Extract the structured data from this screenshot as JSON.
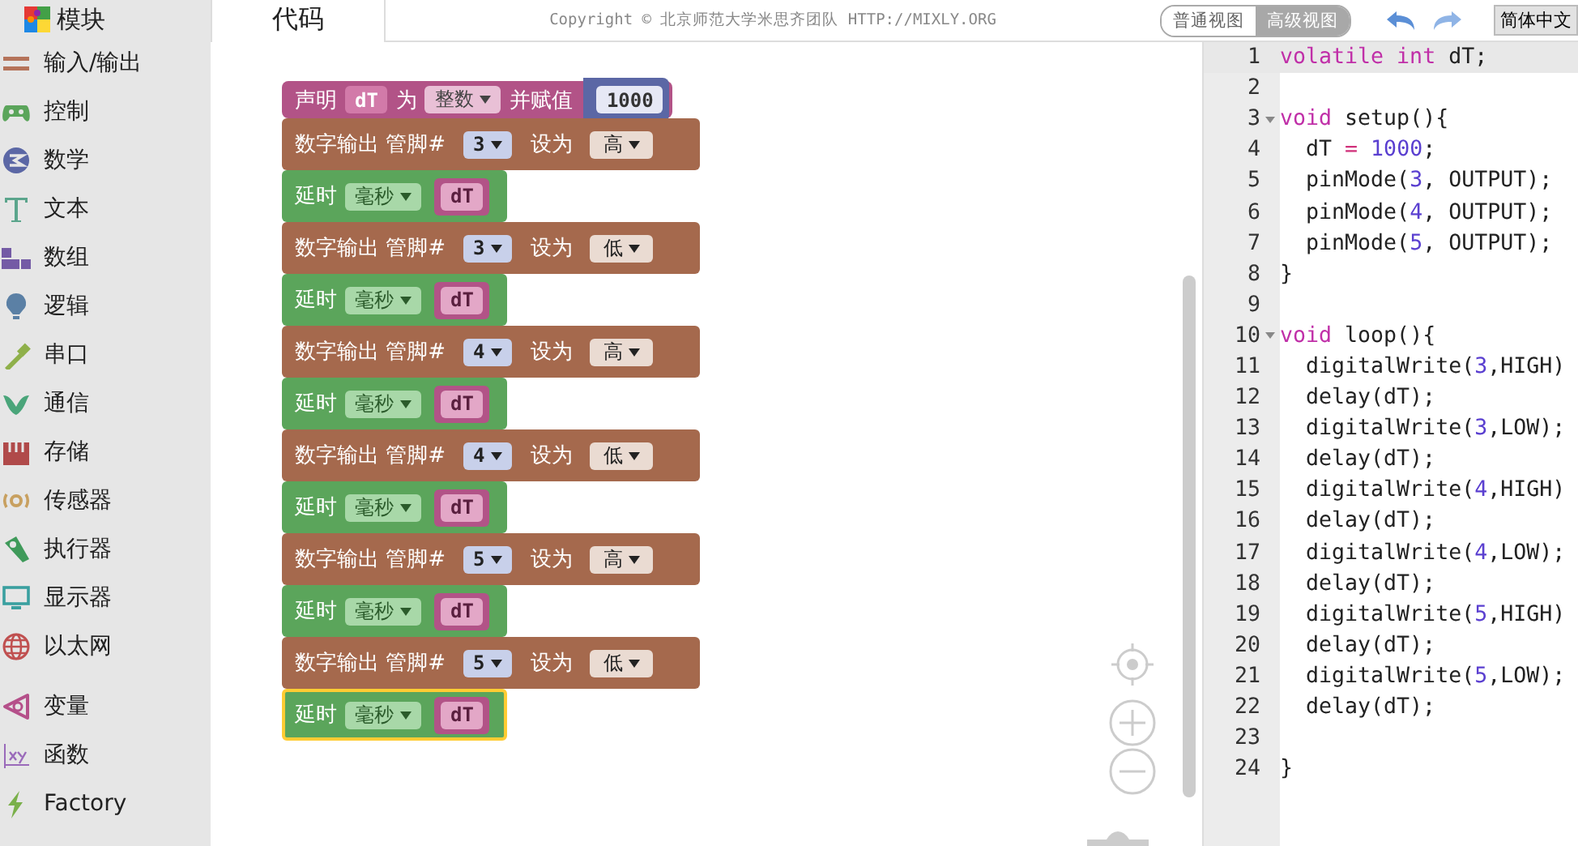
{
  "sidebar": {
    "title": "模块",
    "groups": [
      {
        "items": [
          {
            "label": "输入/输出",
            "color": "#b5735a"
          },
          {
            "label": "控制",
            "color": "#5ba55b"
          },
          {
            "label": "数学",
            "color": "#5b67a5"
          },
          {
            "label": "文本",
            "color": "#5ba58c"
          },
          {
            "label": "数组",
            "color": "#745ba5"
          },
          {
            "label": "逻辑",
            "color": "#5b80a5"
          },
          {
            "label": "串口",
            "color": "#8fb04a"
          },
          {
            "label": "通信",
            "color": "#4aa57a"
          },
          {
            "label": "存储",
            "color": "#b04a4a"
          },
          {
            "label": "传感器",
            "color": "#c8a060"
          },
          {
            "label": "执行器",
            "color": "#3f9a5a"
          },
          {
            "label": "显示器",
            "color": "#3aa0a0"
          },
          {
            "label": "以太网",
            "color": "#c05050"
          }
        ]
      },
      {
        "items": [
          {
            "label": "变量",
            "color": "#b5508a"
          },
          {
            "label": "函数",
            "color": "#9a6aba"
          },
          {
            "label": "Factory",
            "color": "#7ab04a"
          }
        ]
      }
    ]
  },
  "toolbar": {
    "tab": {
      "label": "代码",
      "selected": true
    },
    "copyright": "Copyright © 北京师范大学米思齐团队 HTTP://MIXLY.ORG",
    "views": [
      {
        "label": "普通视图",
        "selected": false
      },
      {
        "label": "高级视图",
        "selected": true
      }
    ],
    "language": "简体中文"
  },
  "blocks": [
    {
      "kind": "declare",
      "label": "声明",
      "variable": "dT",
      "connector": "为",
      "type": "整数",
      "assign": "并赋值",
      "value": "1000",
      "selected": false
    },
    {
      "kind": "digital_write",
      "label": "数字输出 管脚#",
      "pin": "3",
      "set_label": "设为",
      "level_value": "高",
      "selected": false
    },
    {
      "kind": "delay",
      "label": "延时",
      "unit": "毫秒",
      "value": "dT",
      "selected": false
    },
    {
      "kind": "digital_write",
      "label": "数字输出 管脚#",
      "pin": "3",
      "set_label": "设为",
      "level_value": "低",
      "selected": false
    },
    {
      "kind": "delay",
      "label": "延时",
      "unit": "毫秒",
      "value": "dT",
      "selected": false
    },
    {
      "kind": "digital_write",
      "label": "数字输出 管脚#",
      "pin": "4",
      "set_label": "设为",
      "level_value": "高",
      "selected": false
    },
    {
      "kind": "delay",
      "label": "延时",
      "unit": "毫秒",
      "value": "dT",
      "selected": false
    },
    {
      "kind": "digital_write",
      "label": "数字输出 管脚#",
      "pin": "4",
      "set_label": "设为",
      "level_value": "低",
      "selected": false
    },
    {
      "kind": "delay",
      "label": "延时",
      "unit": "毫秒",
      "value": "dT",
      "selected": false
    },
    {
      "kind": "digital_write",
      "label": "数字输出 管脚#",
      "pin": "5",
      "set_label": "设为",
      "level_value": "高",
      "selected": false
    },
    {
      "kind": "delay",
      "label": "延时",
      "unit": "毫秒",
      "value": "dT",
      "selected": false
    },
    {
      "kind": "digital_write",
      "label": "数字输出 管脚#",
      "pin": "5",
      "set_label": "设为",
      "level_value": "低",
      "selected": false
    },
    {
      "kind": "delay",
      "label": "延时",
      "unit": "毫秒",
      "value": "dT",
      "selected": true
    }
  ],
  "code": {
    "lines": [
      {
        "number": "1",
        "fold": false,
        "selected": true,
        "tokens": [
          {
            "kind": "keyword",
            "text": "volatile"
          },
          {
            "kind": "keyword",
            "text": " int"
          },
          {
            "kind": "plain",
            "text": " dT;"
          }
        ]
      },
      {
        "number": "2",
        "fold": false,
        "selected": false
      },
      {
        "number": "3",
        "fold": true,
        "selected": false,
        "tokens": [
          {
            "kind": "keyword",
            "text": "void"
          },
          {
            "kind": "plain",
            "text": " setup(){"
          }
        ]
      },
      {
        "number": "4",
        "fold": false,
        "selected": false,
        "tokens": [
          {
            "kind": "plain",
            "text": "  dT "
          },
          {
            "kind": "operator",
            "text": "="
          },
          {
            "kind": "number",
            "text": " 1000"
          },
          {
            "kind": "plain",
            "text": ";"
          }
        ]
      },
      {
        "number": "5",
        "fold": false,
        "selected": false,
        "tokens": [
          {
            "kind": "plain",
            "text": "  pinMode("
          },
          {
            "kind": "number",
            "text": "3"
          },
          {
            "kind": "plain",
            "text": ", OUTPUT);"
          }
        ]
      },
      {
        "number": "6",
        "fold": false,
        "selected": false,
        "tokens": [
          {
            "kind": "plain",
            "text": "  pinMode("
          },
          {
            "kind": "number",
            "text": "4"
          },
          {
            "kind": "plain",
            "text": ", OUTPUT);"
          }
        ]
      },
      {
        "number": "7",
        "fold": false,
        "selected": false,
        "tokens": [
          {
            "kind": "plain",
            "text": "  pinMode("
          },
          {
            "kind": "number",
            "text": "5"
          },
          {
            "kind": "plain",
            "text": ", OUTPUT);"
          }
        ]
      },
      {
        "number": "8",
        "fold": false,
        "selected": false,
        "tokens": [
          {
            "kind": "plain",
            "text": "}"
          }
        ]
      },
      {
        "number": "9",
        "fold": false,
        "selected": false
      },
      {
        "number": "10",
        "fold": true,
        "selected": false,
        "tokens": [
          {
            "kind": "keyword",
            "text": "void"
          },
          {
            "kind": "plain",
            "text": " loop(){"
          }
        ]
      },
      {
        "number": "11",
        "fold": false,
        "selected": false,
        "tokens": [
          {
            "kind": "plain",
            "text": "  digitalWrite("
          },
          {
            "kind": "number",
            "text": "3"
          },
          {
            "kind": "plain",
            "text": ",HIGH)"
          }
        ]
      },
      {
        "number": "12",
        "fold": false,
        "selected": false,
        "tokens": [
          {
            "kind": "plain",
            "text": "  delay(dT);"
          }
        ]
      },
      {
        "number": "13",
        "fold": false,
        "selected": false,
        "tokens": [
          {
            "kind": "plain",
            "text": "  digitalWrite("
          },
          {
            "kind": "number",
            "text": "3"
          },
          {
            "kind": "plain",
            "text": ",LOW);"
          }
        ]
      },
      {
        "number": "14",
        "fold": false,
        "selected": false,
        "tokens": [
          {
            "kind": "plain",
            "text": "  delay(dT);"
          }
        ]
      },
      {
        "number": "15",
        "fold": false,
        "selected": false,
        "tokens": [
          {
            "kind": "plain",
            "text": "  digitalWrite("
          },
          {
            "kind": "number",
            "text": "4"
          },
          {
            "kind": "plain",
            "text": ",HIGH)"
          }
        ]
      },
      {
        "number": "16",
        "fold": false,
        "selected": false,
        "tokens": [
          {
            "kind": "plain",
            "text": "  delay(dT);"
          }
        ]
      },
      {
        "number": "17",
        "fold": false,
        "selected": false,
        "tokens": [
          {
            "kind": "plain",
            "text": "  digitalWrite("
          },
          {
            "kind": "number",
            "text": "4"
          },
          {
            "kind": "plain",
            "text": ",LOW);"
          }
        ]
      },
      {
        "number": "18",
        "fold": false,
        "selected": false,
        "tokens": [
          {
            "kind": "plain",
            "text": "  delay(dT);"
          }
        ]
      },
      {
        "number": "19",
        "fold": false,
        "selected": false,
        "tokens": [
          {
            "kind": "plain",
            "text": "  digitalWrite("
          },
          {
            "kind": "number",
            "text": "5"
          },
          {
            "kind": "plain",
            "text": ",HIGH)"
          }
        ]
      },
      {
        "number": "20",
        "fold": false,
        "selected": false,
        "tokens": [
          {
            "kind": "plain",
            "text": "  delay(dT);"
          }
        ]
      },
      {
        "number": "21",
        "fold": false,
        "selected": false,
        "tokens": [
          {
            "kind": "plain",
            "text": "  digitalWrite("
          },
          {
            "kind": "number",
            "text": "5"
          },
          {
            "kind": "plain",
            "text": ",LOW);"
          }
        ]
      },
      {
        "number": "22",
        "fold": false,
        "selected": false,
        "tokens": [
          {
            "kind": "plain",
            "text": "  delay(dT);"
          }
        ]
      },
      {
        "number": "23",
        "fold": false,
        "selected": false
      },
      {
        "number": "24",
        "fold": false,
        "selected": false,
        "tokens": [
          {
            "kind": "plain",
            "text": "}"
          }
        ]
      }
    ]
  }
}
